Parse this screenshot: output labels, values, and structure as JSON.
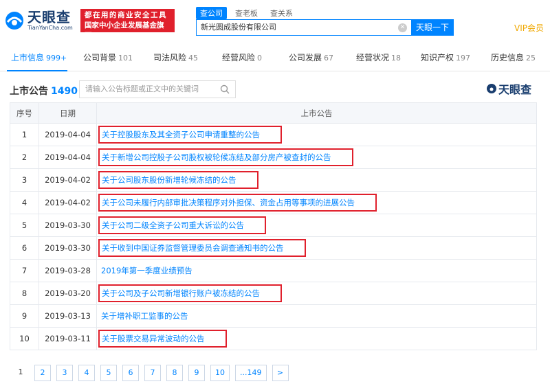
{
  "header": {
    "logo_cn": "天眼查",
    "logo_en": "TianYanCha.com",
    "slogan_line1": "都在用的商业安全工具",
    "slogan_line2": "国家中小企业发展基金旗下",
    "search_tabs": [
      "查公司",
      "查老板",
      "查关系"
    ],
    "search_value": "新光圆成股份有限公司",
    "search_button": "天眼一下",
    "vip_label": "VIP会员"
  },
  "nav": {
    "items": [
      {
        "label": "上市信息",
        "count": "999+"
      },
      {
        "label": "公司背景",
        "count": "101"
      },
      {
        "label": "司法风险",
        "count": "45"
      },
      {
        "label": "经营风险",
        "count": "0"
      },
      {
        "label": "公司发展",
        "count": "67"
      },
      {
        "label": "经营状况",
        "count": "18"
      },
      {
        "label": "知识产权",
        "count": "197"
      },
      {
        "label": "历史信息",
        "count": "25"
      }
    ]
  },
  "section": {
    "title": "上市公告",
    "count": "1490",
    "filter_placeholder": "请输入公告标题或正文中的关键词",
    "brand": "天眼查"
  },
  "table": {
    "headers": [
      "序号",
      "日期",
      "上市公告"
    ],
    "rows": [
      {
        "idx": "1",
        "date": "2019-04-04",
        "title": "关于控股股东及其全资子公司申请重整的公告",
        "boxed": true
      },
      {
        "idx": "2",
        "date": "2019-04-04",
        "title": "关于新增公司控股子公司股权被轮候冻结及部分房产被查封的公告",
        "boxed": true
      },
      {
        "idx": "3",
        "date": "2019-04-02",
        "title": "关于公司股东股份新增轮候冻结的公告",
        "boxed": true
      },
      {
        "idx": "4",
        "date": "2019-04-02",
        "title": "关于公司未履行内部审批决策程序对外担保、资金占用等事项的进展公告",
        "boxed": true
      },
      {
        "idx": "5",
        "date": "2019-03-30",
        "title": "关于公司二级全资子公司重大诉讼的公告",
        "boxed": true
      },
      {
        "idx": "6",
        "date": "2019-03-30",
        "title": "关于收到中国证券监督管理委员会调查通知书的公告",
        "boxed": true
      },
      {
        "idx": "7",
        "date": "2019-03-28",
        "title": "2019年第一季度业绩预告",
        "boxed": false
      },
      {
        "idx": "8",
        "date": "2019-03-20",
        "title": "关于公司及子公司新增银行账户被冻结的公告",
        "boxed": true
      },
      {
        "idx": "9",
        "date": "2019-03-13",
        "title": "关于增补职工监事的公告",
        "boxed": false
      },
      {
        "idx": "10",
        "date": "2019-03-11",
        "title": "关于股票交易异常波动的公告",
        "boxed": true
      }
    ]
  },
  "pager": {
    "current": "1",
    "pages": [
      "2",
      "3",
      "4",
      "5",
      "6",
      "7",
      "8",
      "9",
      "10",
      "...149",
      ">"
    ]
  },
  "colors": {
    "accent": "#0084ff",
    "highlight_box": "#e0202c",
    "brand_navy": "#1a3e6f",
    "vip": "#f0a800"
  }
}
